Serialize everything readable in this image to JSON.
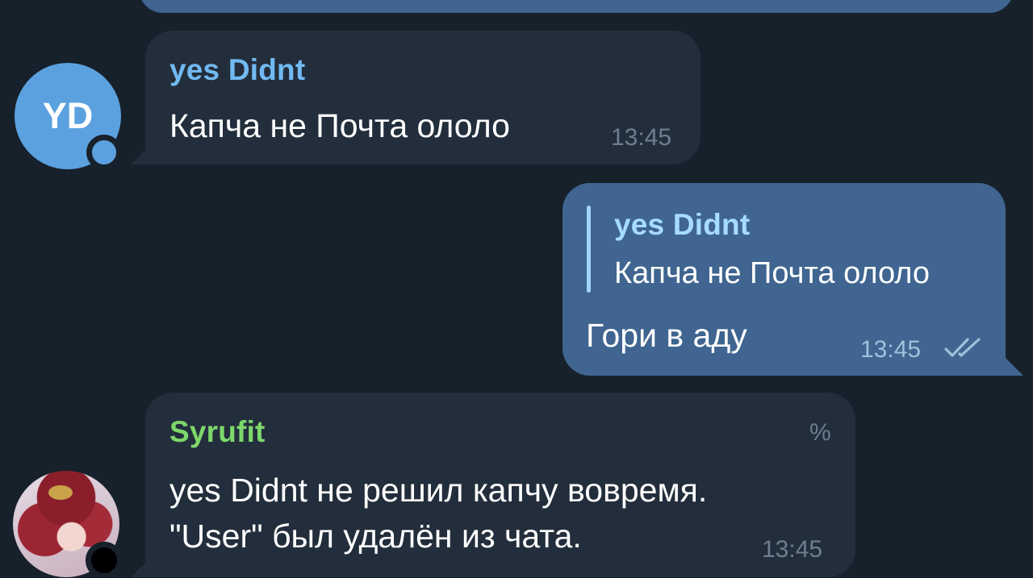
{
  "messages": [
    {
      "sender": "yes Didnt",
      "avatar_initials": "YD",
      "text": "Капча не Почта ололо",
      "time": "13:45"
    },
    {
      "reply": {
        "sender": "yes Didnt",
        "text": "Капча не Почта ололо"
      },
      "text": "Гори в аду",
      "time": "13:45",
      "status_icon": "double-check-icon"
    },
    {
      "sender": "Syrufit",
      "badge": "%",
      "line1": "yes Didnt не решил капчу вовремя.",
      "line2": "\"User\" был удалён из чата.",
      "time": "13:45"
    }
  ],
  "colors": {
    "background": "#17212b",
    "incoming_bubble": "#232e3c",
    "outgoing_bubble": "#3f6590",
    "sender_blue": "#71baf2",
    "sender_green": "#7ed76a",
    "avatar_blue": "#5ca1df"
  }
}
